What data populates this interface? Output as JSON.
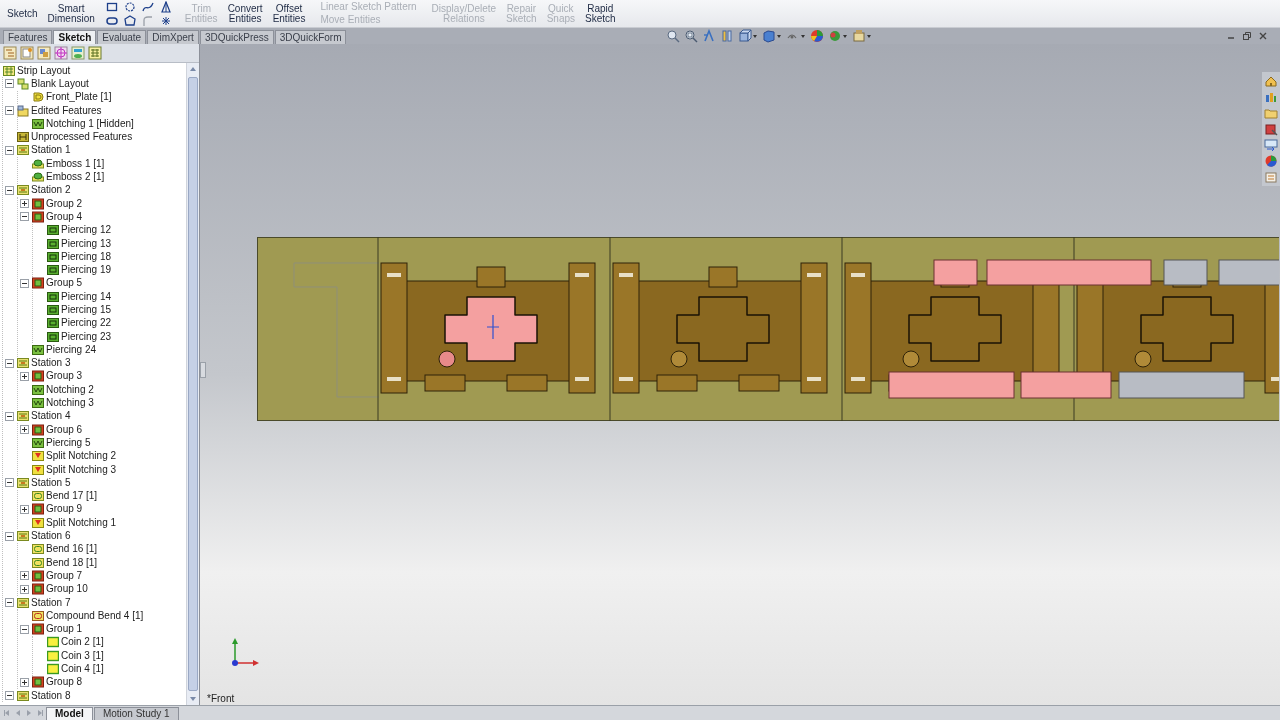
{
  "toolbar": [
    {
      "label": "Sketch",
      "kind": "large",
      "disabled": false
    },
    {
      "label": "Smart Dimension",
      "kind": "large",
      "disabled": false
    },
    {
      "label": "Trim Entities",
      "kind": "large",
      "disabled": true
    },
    {
      "label": "Convert Entities",
      "kind": "large",
      "disabled": false
    },
    {
      "label": "Offset Entities",
      "kind": "large",
      "disabled": false
    },
    {
      "label": "Linear Sketch Pattern",
      "kind": "small",
      "disabled": true
    },
    {
      "label": "Move Entities",
      "kind": "small",
      "disabled": true
    },
    {
      "label": "Display/Delete Relations",
      "kind": "large",
      "disabled": true
    },
    {
      "label": "Repair Sketch",
      "kind": "large",
      "disabled": true
    },
    {
      "label": "Quick Snaps",
      "kind": "large",
      "disabled": true
    },
    {
      "label": "Rapid Sketch",
      "kind": "large",
      "disabled": false
    }
  ],
  "tabs": [
    {
      "label": "Features",
      "selected": false
    },
    {
      "label": "Sketch",
      "selected": true
    },
    {
      "label": "Evaluate",
      "selected": false
    },
    {
      "label": "DimXpert",
      "selected": false
    },
    {
      "label": "3DQuickPress",
      "selected": false
    },
    {
      "label": "3DQuickForm",
      "selected": false
    }
  ],
  "tree": [
    {
      "label": "Strip Layout",
      "kind": "layout",
      "children": [
        {
          "label": "Blank Layout",
          "kind": "blank",
          "expanded": true,
          "children": [
            {
              "label": "Front_Plate [1]",
              "kind": "part"
            }
          ]
        },
        {
          "label": "Edited Features",
          "kind": "edited",
          "expanded": true,
          "children": [
            {
              "label": "Notching 1 [Hidden]",
              "kind": "feature"
            }
          ]
        },
        {
          "label": "Unprocessed Features",
          "kind": "unprocessed"
        },
        {
          "label": "Station 1",
          "kind": "station",
          "expanded": true,
          "children": [
            {
              "label": "Emboss 1 [1]",
              "kind": "emboss"
            },
            {
              "label": "Emboss 2 [1]",
              "kind": "emboss"
            }
          ]
        },
        {
          "label": "Station 2",
          "kind": "station",
          "expanded": true,
          "children": [
            {
              "label": "Group 2",
              "kind": "group",
              "expanded": false
            },
            {
              "label": "Group 4",
              "kind": "group",
              "expanded": true,
              "children": [
                {
                  "label": "Piercing 12",
                  "kind": "piercing"
                },
                {
                  "label": "Piercing 13",
                  "kind": "piercing"
                },
                {
                  "label": "Piercing 18",
                  "kind": "piercing"
                },
                {
                  "label": "Piercing 19",
                  "kind": "piercing"
                }
              ]
            },
            {
              "label": "Group 5",
              "kind": "group",
              "expanded": true,
              "children": [
                {
                  "label": "Piercing 14",
                  "kind": "piercing"
                },
                {
                  "label": "Piercing 15",
                  "kind": "piercing"
                },
                {
                  "label": "Piercing 22",
                  "kind": "piercing"
                },
                {
                  "label": "Piercing 23",
                  "kind": "piercing"
                }
              ]
            },
            {
              "label": "Piercing 24",
              "kind": "feature"
            }
          ]
        },
        {
          "label": "Station 3",
          "kind": "station",
          "expanded": true,
          "children": [
            {
              "label": "Group 3",
              "kind": "group",
              "expanded": false
            },
            {
              "label": "Notching 2",
              "kind": "feature"
            },
            {
              "label": "Notching 3",
              "kind": "feature"
            }
          ]
        },
        {
          "label": "Station 4",
          "kind": "station",
          "expanded": true,
          "children": [
            {
              "label": "Group 6",
              "kind": "group",
              "expanded": false
            },
            {
              "label": "Piercing 5",
              "kind": "feature"
            },
            {
              "label": "Split Notching 2",
              "kind": "split"
            },
            {
              "label": "Split Notching 3",
              "kind": "split"
            }
          ]
        },
        {
          "label": "Station 5",
          "kind": "station",
          "expanded": true,
          "children": [
            {
              "label": "Bend 17 [1]",
              "kind": "bend"
            },
            {
              "label": "Group 9",
              "kind": "group",
              "expanded": false
            },
            {
              "label": "Split Notching 1",
              "kind": "split"
            }
          ]
        },
        {
          "label": "Station 6",
          "kind": "station",
          "expanded": true,
          "children": [
            {
              "label": "Bend 16 [1]",
              "kind": "bend"
            },
            {
              "label": "Bend 18 [1]",
              "kind": "bend"
            },
            {
              "label": "Group 7",
              "kind": "group",
              "expanded": false
            },
            {
              "label": "Group 10",
              "kind": "group",
              "expanded": false
            }
          ]
        },
        {
          "label": "Station 7",
          "kind": "station",
          "expanded": true,
          "children": [
            {
              "label": "Compound Bend 4 [1]",
              "kind": "compound"
            },
            {
              "label": "Group 1",
              "kind": "group",
              "expanded": true,
              "children": [
                {
                  "label": "Coin 2 [1]",
                  "kind": "coin"
                },
                {
                  "label": "Coin 3 [1]",
                  "kind": "coin"
                },
                {
                  "label": "Coin 4 [1]",
                  "kind": "coin"
                }
              ]
            },
            {
              "label": "Group 8",
              "kind": "group",
              "expanded": false
            }
          ]
        },
        {
          "label": "Station 8",
          "kind": "station",
          "expanded": true
        }
      ]
    }
  ],
  "viewport": {
    "view_name": "*Front"
  },
  "bottom_tabs": [
    {
      "label": "Model",
      "selected": true
    },
    {
      "label": "Motion Study 1",
      "selected": false
    }
  ]
}
